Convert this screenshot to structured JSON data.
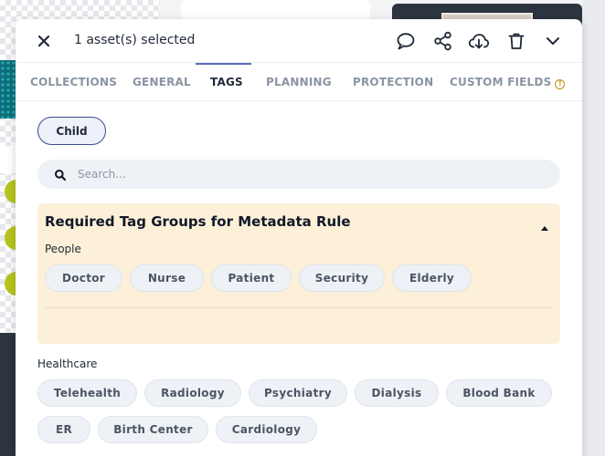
{
  "header": {
    "title": "1 asset(s) selected",
    "close_icon": "close-icon",
    "actions": [
      "comment-icon",
      "share-icon",
      "download-icon",
      "trash-icon",
      "chevron-down-icon"
    ]
  },
  "tabs": [
    {
      "label": "COLLECTIONS",
      "active": false
    },
    {
      "label": "GENERAL",
      "active": false
    },
    {
      "label": "TAGS",
      "active": true
    },
    {
      "label": "PLANNING",
      "active": false
    },
    {
      "label": "PROTECTION",
      "active": false
    },
    {
      "label": "CUSTOM FIELDS",
      "active": false,
      "badge": "!"
    }
  ],
  "selected_tags": [
    "Child"
  ],
  "search": {
    "placeholder": "Search...",
    "value": ""
  },
  "rule_box": {
    "title": "Required Tag Groups for Metadata Rule",
    "group_label": "People",
    "tags": [
      "Doctor",
      "Nurse",
      "Patient",
      "Security",
      "Elderly"
    ]
  },
  "healthcare": {
    "label": "Healthcare",
    "tags": [
      "Telehealth",
      "Radiology",
      "Psychiatry",
      "Dialysis",
      "Blood Bank",
      "ER",
      "Birth Center",
      "Cardiology"
    ]
  },
  "colors": {
    "accent": "#5b6bb5",
    "rule_bg": "#fdf0d9",
    "pill_bg": "#eef2f7",
    "warning": "#c48a11"
  }
}
